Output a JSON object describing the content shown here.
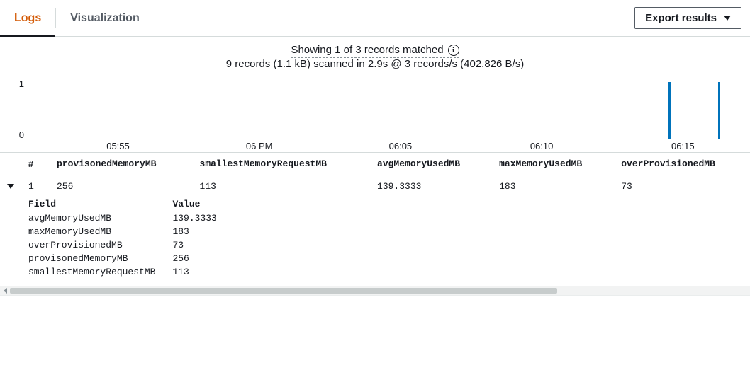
{
  "tabs": {
    "logs": "Logs",
    "visualization": "Visualization"
  },
  "export_label": "Export results",
  "summary": {
    "line1": "Showing 1 of 3 records matched",
    "line2": "9 records (1.1 kB) scanned in 2.9s @ 3 records/s (402.826 B/s)"
  },
  "chart_data": {
    "type": "bar",
    "ylim": [
      0,
      1
    ],
    "y_ticks": [
      "0",
      "1"
    ],
    "x_ticks": [
      {
        "label": "05:55",
        "pos_pct": 12.5
      },
      {
        "label": "06 PM",
        "pos_pct": 32.5
      },
      {
        "label": "06:05",
        "pos_pct": 52.5
      },
      {
        "label": "06:10",
        "pos_pct": 72.5
      },
      {
        "label": "06:15",
        "pos_pct": 92.5
      }
    ],
    "bars": [
      {
        "pos_pct": 90.5,
        "value": 1
      },
      {
        "pos_pct": 97.5,
        "value": 1
      }
    ]
  },
  "columns": {
    "row_num": "#",
    "c0": "provisonedMemoryMB",
    "c1": "smallestMemoryRequestMB",
    "c2": "avgMemoryUsedMB",
    "c3": "maxMemoryUsedMB",
    "c4": "overProvisionedMB"
  },
  "rows": [
    {
      "idx": "1",
      "provisonedMemoryMB": "256",
      "smallestMemoryRequestMB": "113",
      "avgMemoryUsedMB": "139.3333",
      "maxMemoryUsedMB": "183",
      "overProvisionedMB": "73"
    }
  ],
  "detail": {
    "header_field": "Field",
    "header_value": "Value",
    "items": [
      {
        "field": "avgMemoryUsedMB",
        "value": "139.3333"
      },
      {
        "field": "maxMemoryUsedMB",
        "value": "183"
      },
      {
        "field": "overProvisionedMB",
        "value": "73"
      },
      {
        "field": "provisonedMemoryMB",
        "value": "256"
      },
      {
        "field": "smallestMemoryRequestMB",
        "value": "113"
      }
    ]
  }
}
